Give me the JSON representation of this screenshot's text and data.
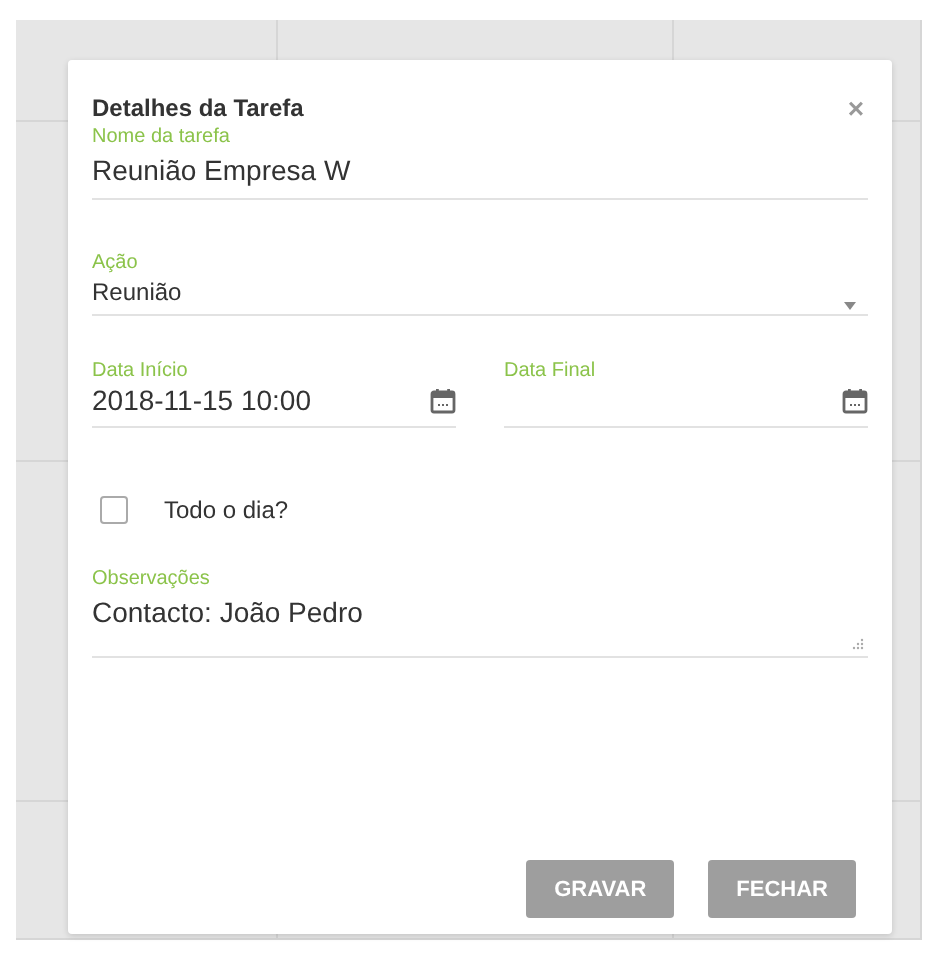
{
  "dialog": {
    "title": "Detalhes da Tarefa",
    "close": "×",
    "name_field": {
      "label": "Nome da tarefa",
      "value": "Reunião Empresa W"
    },
    "action_field": {
      "label": "Ação",
      "value": "Reunião"
    },
    "start_date": {
      "label": "Data Início",
      "value": "2018-11-15 10:00"
    },
    "end_date": {
      "label": "Data Final"
    },
    "all_day": {
      "label": "Todo o dia?",
      "checked": false
    },
    "notes": {
      "label": "Observações",
      "value": "Contacto: João Pedro"
    },
    "buttons": [
      {
        "label": "GRAVAR"
      },
      {
        "label": "FECHAR"
      }
    ]
  }
}
